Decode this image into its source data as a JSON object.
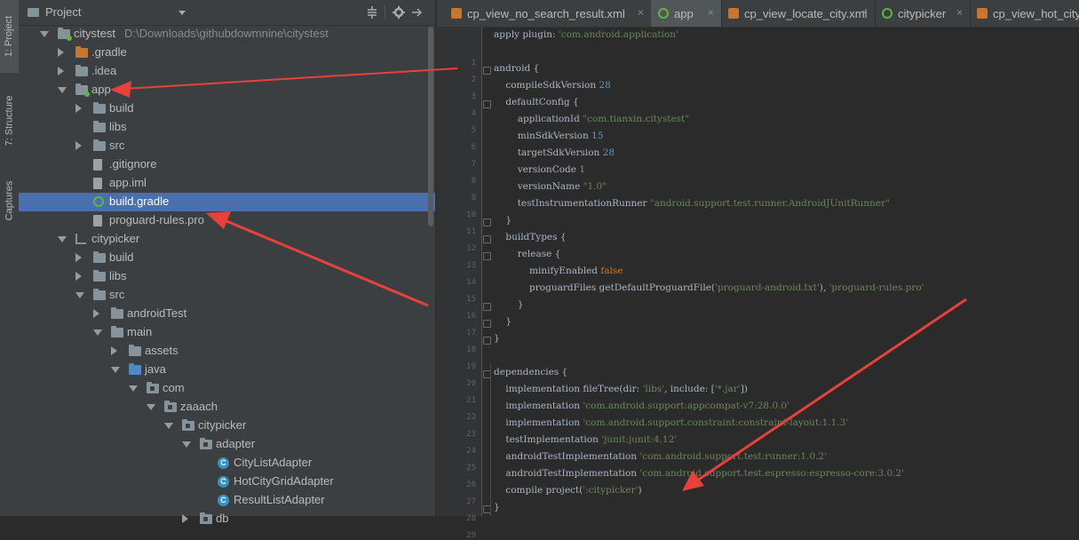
{
  "stripe": {
    "tabs": [
      {
        "label": "1: Project"
      },
      {
        "label": "7: Structure"
      },
      {
        "label": "Captures"
      }
    ]
  },
  "project": {
    "title": "Project",
    "tree": [
      {
        "label": "citystest",
        "path": "D:\\Downloads\\githubdowmnine\\citystest",
        "icon": "module-folder-icon",
        "arrow": "open"
      },
      {
        "label": ".gradle",
        "icon": "folder-icon",
        "color": "#c57633",
        "arrow": "closed"
      },
      {
        "label": ".idea",
        "icon": "folder-icon",
        "arrow": "closed"
      },
      {
        "label": "app",
        "icon": "module-folder-icon",
        "arrow": "open"
      },
      {
        "label": "build",
        "icon": "folder-icon",
        "arrow": "closed"
      },
      {
        "label": "libs",
        "icon": "folder-icon",
        "arrow": "none"
      },
      {
        "label": "src",
        "icon": "folder-icon",
        "arrow": "closed"
      },
      {
        "label": ".gitignore",
        "icon": "file-icon",
        "arrow": "none"
      },
      {
        "label": "app.iml",
        "icon": "file-icon",
        "arrow": "none"
      },
      {
        "label": "build.gradle",
        "icon": "gradle-icon",
        "arrow": "none",
        "selected": true
      },
      {
        "label": "proguard-rules.pro",
        "icon": "file-icon",
        "arrow": "none"
      },
      {
        "label": "citypicker",
        "icon": "library-module-icon",
        "arrow": "open"
      },
      {
        "label": "build",
        "icon": "folder-icon",
        "arrow": "closed"
      },
      {
        "label": "libs",
        "icon": "folder-icon",
        "arrow": "closed"
      },
      {
        "label": "src",
        "icon": "folder-icon",
        "arrow": "open"
      },
      {
        "label": "androidTest",
        "icon": "folder-icon",
        "arrow": "closed"
      },
      {
        "label": "main",
        "icon": "folder-icon",
        "arrow": "open"
      },
      {
        "label": "assets",
        "icon": "folder-icon",
        "arrow": "closed"
      },
      {
        "label": "java",
        "icon": "source-folder-icon",
        "color": "#4e8bc5",
        "arrow": "open"
      },
      {
        "label": "com",
        "icon": "package-icon",
        "arrow": "open"
      },
      {
        "label": "zaaach",
        "icon": "package-icon",
        "arrow": "open"
      },
      {
        "label": "citypicker",
        "icon": "package-icon",
        "arrow": "open"
      },
      {
        "label": "adapter",
        "icon": "package-icon",
        "arrow": "open"
      },
      {
        "label": "CityListAdapter",
        "icon": "class-icon",
        "arrow": "none"
      },
      {
        "label": "HotCityGridAdapter",
        "icon": "class-icon",
        "arrow": "none"
      },
      {
        "label": "ResultListAdapter",
        "icon": "class-icon",
        "arrow": "none"
      },
      {
        "label": "db",
        "icon": "package-icon",
        "arrow": "closed"
      }
    ]
  },
  "editor": {
    "tabs": [
      {
        "label": "cp_view_no_search_result.xml",
        "icon": "xml-file-icon",
        "close": "×"
      },
      {
        "label": "app",
        "icon": "gradle-icon",
        "close": "×",
        "active": true
      },
      {
        "label": "cp_view_locate_city.xml",
        "icon": "xml-file-icon",
        "close": "×"
      },
      {
        "label": "citypicker",
        "icon": "gradle-icon",
        "close": "×"
      },
      {
        "label": "cp_view_hot_city.",
        "icon": "xml-file-icon",
        "close": ""
      }
    ],
    "lines": [
      "apply plugin: 'com.android.application'",
      "",
      "android {",
      "    compileSdkVersion 28",
      "    defaultConfig {",
      "        applicationId \"com.tianxin.citystest\"",
      "        minSdkVersion 15",
      "        targetSdkVersion 28",
      "        versionCode 1",
      "        versionName \"1.0\"",
      "        testInstrumentationRunner \"android.support.test.runner.AndroidJUnitRunner\"",
      "    }",
      "    buildTypes {",
      "        release {",
      "            minifyEnabled false",
      "            proguardFiles getDefaultProguardFile('proguard-android.txt'), 'proguard-rules.pro'",
      "        }",
      "    }",
      "}",
      "",
      "dependencies {",
      "    implementation fileTree(dir: 'libs', include: ['*.jar'])",
      "    implementation 'com.android.support:appcompat-v7:28.0.0'",
      "    implementation 'com.android.support.constraint:constraint-layout:1.1.3'",
      "    testImplementation 'junit:junit:4.12'",
      "    androidTestImplementation 'com.android.support.test:runner:1.0.2'",
      "    androidTestImplementation 'com.android.support.test.espresso:espresso-core:3.0.2'",
      "    compile project(':citypicker')",
      "}"
    ]
  },
  "colors": {
    "keyword": "#cc7832",
    "string": "#6a8759",
    "number": "#6897bb",
    "default": "#a9b7c6",
    "selection": "#4b6eaf",
    "annotation": "#e8413b"
  }
}
